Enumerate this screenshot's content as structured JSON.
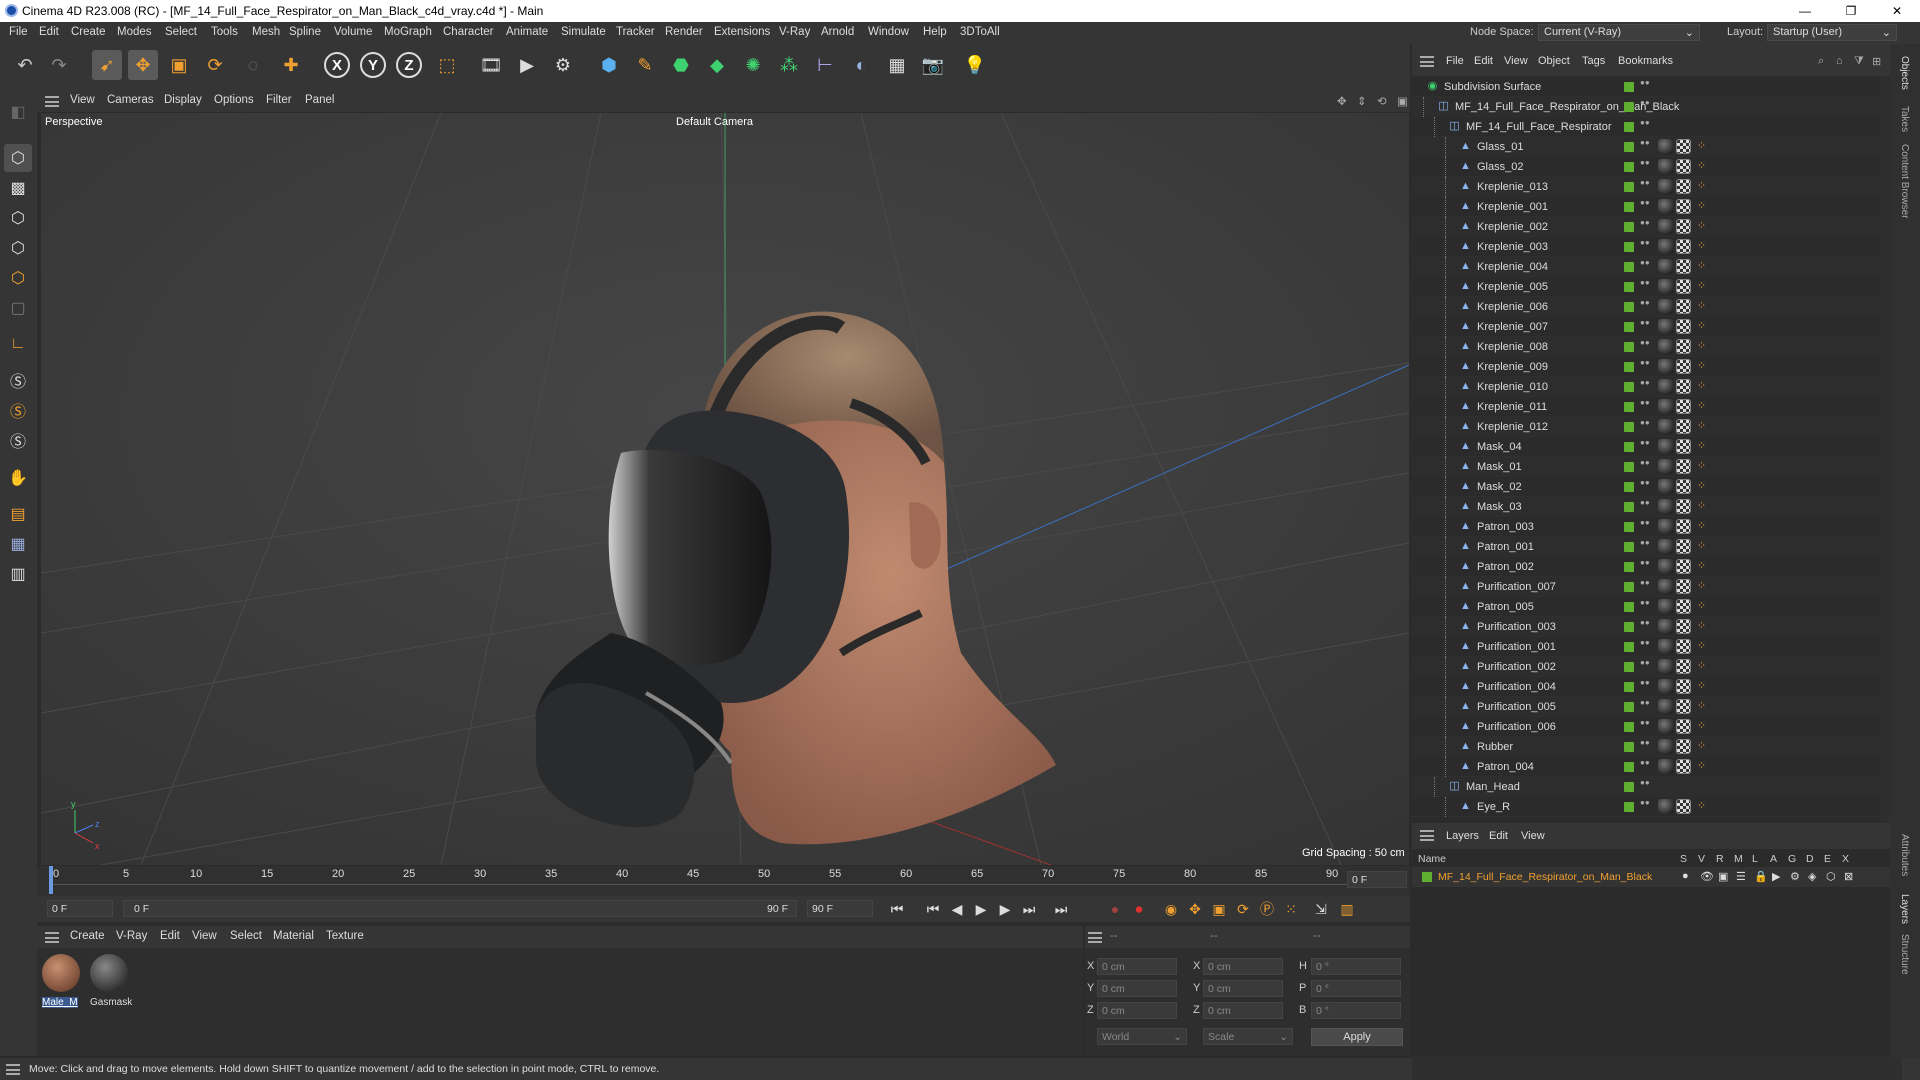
{
  "app": {
    "title": "Cinema 4D R23.008 (RC) - [MF_14_Full_Face_Respirator_on_Man_Black_c4d_vray.c4d *] - Main"
  },
  "menu": [
    "File",
    "Edit",
    "Create",
    "Modes",
    "Select",
    "Tools",
    "Mesh",
    "Spline",
    "Volume",
    "MoGraph",
    "Character",
    "Animate",
    "Simulate",
    "Tracker",
    "Render",
    "Extensions",
    "V-Ray",
    "Arnold",
    "Window",
    "Help",
    "3DToAll"
  ],
  "topright": {
    "node_space_label": "Node Space:",
    "node_space_value": "Current (V-Ray)",
    "layout_label": "Layout:",
    "layout_value": "Startup (User)"
  },
  "viewport": {
    "menu": [
      "View",
      "Cameras",
      "Display",
      "Options",
      "Filter",
      "Panel"
    ],
    "name": "Perspective",
    "camera": "Default Camera",
    "grid_spacing": "Grid Spacing : 50 cm"
  },
  "timeline": {
    "ticks": [
      "0",
      "5",
      "10",
      "15",
      "20",
      "25",
      "30",
      "35",
      "40",
      "45",
      "50",
      "55",
      "60",
      "65",
      "70",
      "75",
      "80",
      "85",
      "90"
    ],
    "current_frame": "0 F"
  },
  "transport": {
    "start": "0 F",
    "range_start": "0 F",
    "range_end": "90 F",
    "end": "90 F"
  },
  "materials": {
    "menu": [
      "Create",
      "V-Ray",
      "Edit",
      "View",
      "Select",
      "Material",
      "Texture"
    ],
    "items": [
      {
        "name": "Male_M"
      },
      {
        "name": "Gasmask"
      }
    ]
  },
  "coords": {
    "headers": [
      "--",
      "--",
      "--"
    ],
    "rows": [
      {
        "a": "X",
        "v1": "0 cm",
        "b": "X",
        "v2": "0 cm",
        "c": "H",
        "v3": "0 °"
      },
      {
        "a": "Y",
        "v1": "0 cm",
        "b": "Y",
        "v2": "0 cm",
        "c": "P",
        "v3": "0 °"
      },
      {
        "a": "Z",
        "v1": "0 cm",
        "b": "Z",
        "v2": "0 cm",
        "c": "B",
        "v3": "0 °"
      }
    ],
    "world": "World",
    "scale": "Scale",
    "apply": "Apply"
  },
  "status": "Move: Click and drag to move elements. Hold down SHIFT to quantize movement / add to the selection in point mode, CTRL to remove.",
  "objects": {
    "menu": [
      "File",
      "Edit",
      "View",
      "Object",
      "Tags",
      "Bookmarks"
    ],
    "items": [
      {
        "name": "Subdivision Surface",
        "level": 0,
        "kind": "subdiv"
      },
      {
        "name": "MF_14_Full_Face_Respirator_on_Man_Black",
        "level": 1,
        "kind": "null"
      },
      {
        "name": "MF_14_Full_Face_Respirator",
        "level": 2,
        "kind": "null"
      },
      {
        "name": "Glass_01",
        "level": 3,
        "kind": "mesh"
      },
      {
        "name": "Glass_02",
        "level": 3,
        "kind": "mesh"
      },
      {
        "name": "Kreplenie_013",
        "level": 3,
        "kind": "mesh"
      },
      {
        "name": "Kreplenie_001",
        "level": 3,
        "kind": "mesh"
      },
      {
        "name": "Kreplenie_002",
        "level": 3,
        "kind": "mesh"
      },
      {
        "name": "Kreplenie_003",
        "level": 3,
        "kind": "mesh"
      },
      {
        "name": "Kreplenie_004",
        "level": 3,
        "kind": "mesh"
      },
      {
        "name": "Kreplenie_005",
        "level": 3,
        "kind": "mesh"
      },
      {
        "name": "Kreplenie_006",
        "level": 3,
        "kind": "mesh"
      },
      {
        "name": "Kreplenie_007",
        "level": 3,
        "kind": "mesh"
      },
      {
        "name": "Kreplenie_008",
        "level": 3,
        "kind": "mesh"
      },
      {
        "name": "Kreplenie_009",
        "level": 3,
        "kind": "mesh"
      },
      {
        "name": "Kreplenie_010",
        "level": 3,
        "kind": "mesh"
      },
      {
        "name": "Kreplenie_011",
        "level": 3,
        "kind": "mesh"
      },
      {
        "name": "Kreplenie_012",
        "level": 3,
        "kind": "mesh"
      },
      {
        "name": "Mask_04",
        "level": 3,
        "kind": "mesh"
      },
      {
        "name": "Mask_01",
        "level": 3,
        "kind": "mesh"
      },
      {
        "name": "Mask_02",
        "level": 3,
        "kind": "mesh"
      },
      {
        "name": "Mask_03",
        "level": 3,
        "kind": "mesh"
      },
      {
        "name": "Patron_003",
        "level": 3,
        "kind": "mesh"
      },
      {
        "name": "Patron_001",
        "level": 3,
        "kind": "mesh"
      },
      {
        "name": "Patron_002",
        "level": 3,
        "kind": "mesh"
      },
      {
        "name": "Purification_007",
        "level": 3,
        "kind": "mesh"
      },
      {
        "name": "Patron_005",
        "level": 3,
        "kind": "mesh"
      },
      {
        "name": "Purification_003",
        "level": 3,
        "kind": "mesh"
      },
      {
        "name": "Purification_001",
        "level": 3,
        "kind": "mesh"
      },
      {
        "name": "Purification_002",
        "level": 3,
        "kind": "mesh"
      },
      {
        "name": "Purification_004",
        "level": 3,
        "kind": "mesh"
      },
      {
        "name": "Purification_005",
        "level": 3,
        "kind": "mesh"
      },
      {
        "name": "Purification_006",
        "level": 3,
        "kind": "mesh"
      },
      {
        "name": "Rubber",
        "level": 3,
        "kind": "mesh"
      },
      {
        "name": "Patron_004",
        "level": 3,
        "kind": "mesh"
      },
      {
        "name": "Man_Head",
        "level": 2,
        "kind": "null"
      },
      {
        "name": "Eye_R",
        "level": 3,
        "kind": "mesh"
      }
    ]
  },
  "layers": {
    "menu": [
      "Layers",
      "Edit",
      "View"
    ],
    "col_name": "Name",
    "cols": [
      "S",
      "V",
      "R",
      "M",
      "L",
      "A",
      "G",
      "D",
      "E",
      "X"
    ],
    "item": "MF_14_Full_Face_Respirator_on_Man_Black"
  },
  "sidetabs": [
    "Objects",
    "Takes",
    "Content Browser",
    "Attributes",
    "Layers",
    "Structure"
  ]
}
